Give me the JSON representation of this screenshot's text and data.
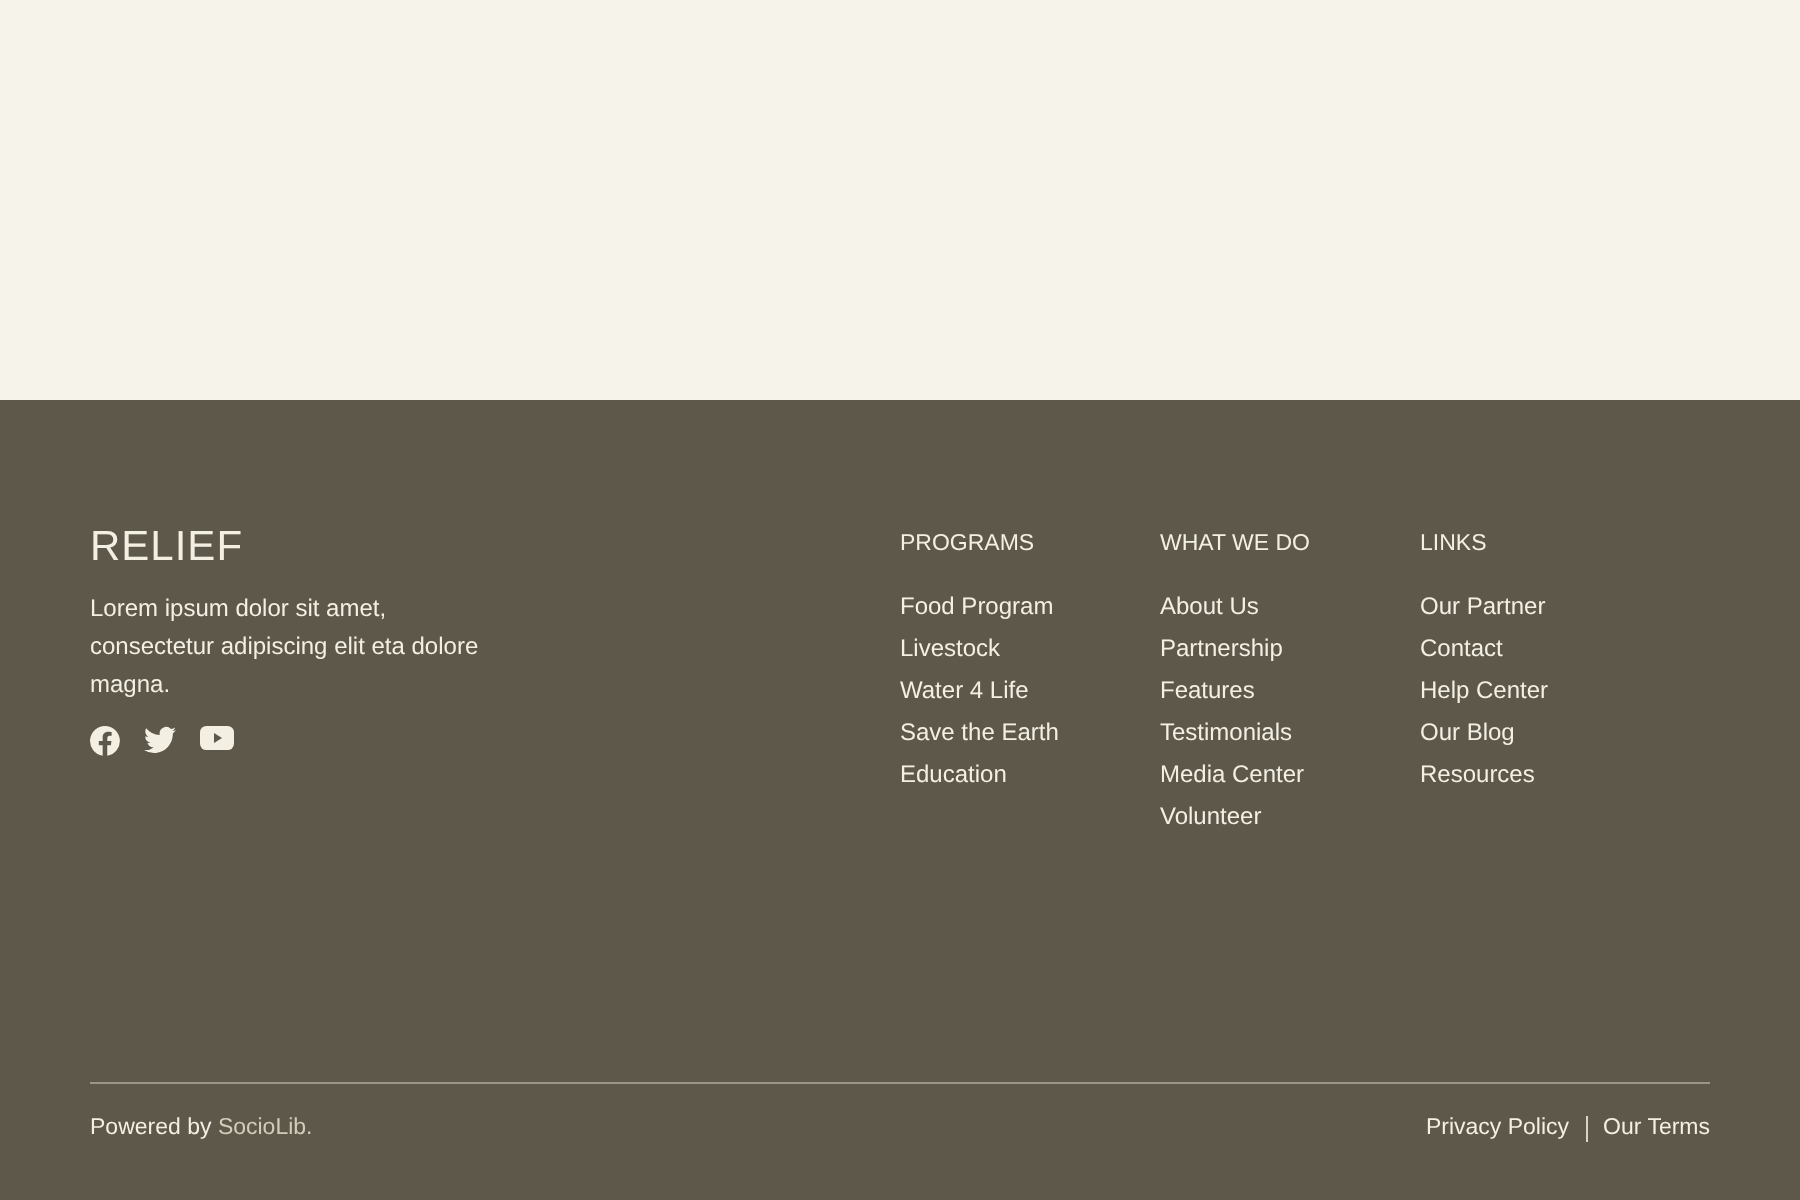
{
  "brand": {
    "name": "RELIEF",
    "description": "Lorem ipsum dolor sit amet, consectetur adipiscing elit eta dolore magna."
  },
  "social": [
    {
      "kind": "facebook"
    },
    {
      "kind": "twitter"
    },
    {
      "kind": "youtube"
    }
  ],
  "columns": [
    {
      "heading": "PROGRAMS",
      "items": [
        "Food Program",
        "Livestock",
        "Water 4 Life",
        "Save the Earth",
        "Education"
      ]
    },
    {
      "heading": "WHAT WE DO",
      "items": [
        "About Us",
        "Partnership",
        "Features",
        "Testimonials",
        "Media Center",
        "Volunteer"
      ]
    },
    {
      "heading": "LINKS",
      "items": [
        "Our Partner",
        "Contact",
        "Help Center",
        "Our Blog",
        "Resources"
      ]
    }
  ],
  "powered_by": {
    "text": "Powered by",
    "link": "SocioLib."
  },
  "legal_links": [
    "Privacy Policy",
    "Our Terms"
  ]
}
